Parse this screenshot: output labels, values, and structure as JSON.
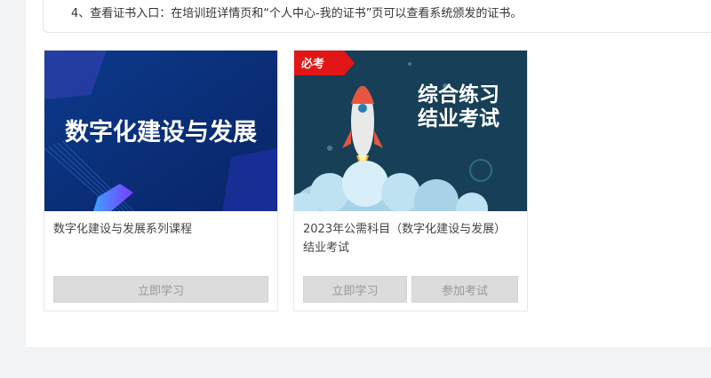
{
  "notice": {
    "text": "4、查看证书入口：在培训班详情页和“个人中心-我的证书”页可以查看系统颁发的证书。"
  },
  "cards": [
    {
      "banner_text": "数字化建设与发展",
      "title": "数字化建设与发展系列课程",
      "buttons": {
        "study": "立即学习"
      }
    },
    {
      "badge": "必考",
      "banner_line1": "综合练习",
      "banner_line2": "结业考试",
      "title": "2023年公需科目（数字化建设与发展）结业考试",
      "buttons": {
        "study": "立即学习",
        "exam": "参加考试"
      }
    }
  ],
  "colors": {
    "card1_bg": "#0d2f7a",
    "card2_bg": "#173f57",
    "badge_red": "#e21616",
    "button_bg": "#dcdcdc"
  },
  "icons": [
    "rocket-icon",
    "cloud-icon"
  ]
}
